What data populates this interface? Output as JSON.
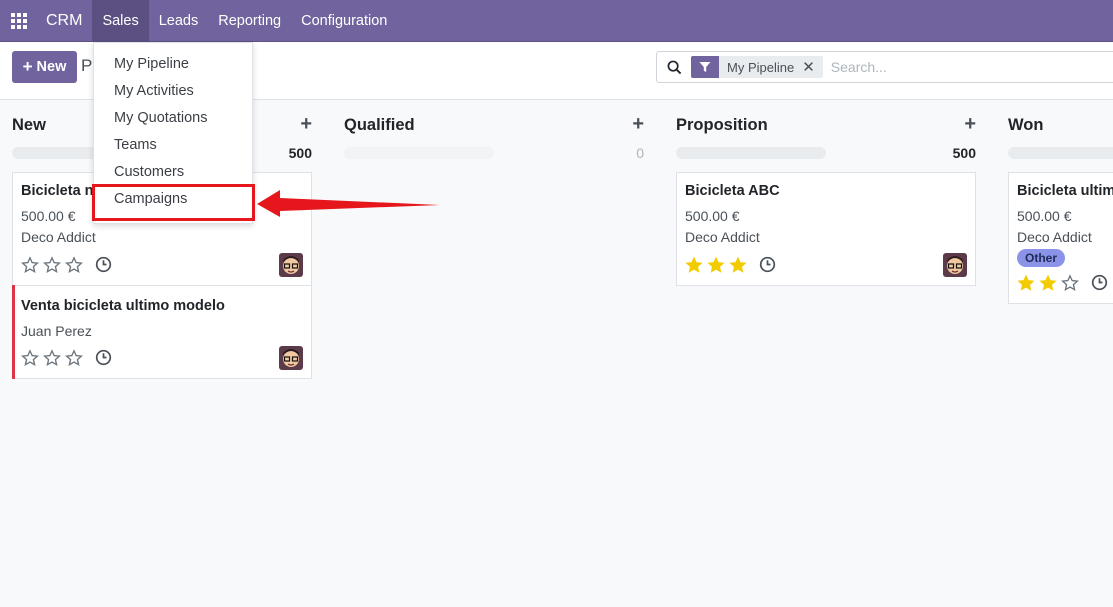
{
  "navbar": {
    "brand": "CRM",
    "items": [
      "Sales",
      "Leads",
      "Reporting",
      "Configuration"
    ]
  },
  "control_panel": {
    "new_label": "New",
    "breadcrumb": "Pi",
    "facet_label": "My Pipeline",
    "search_placeholder": "Search..."
  },
  "sales_menu": {
    "items": [
      "My Pipeline",
      "My Activities",
      "My Quotations",
      "Teams",
      "Customers",
      "Campaigns"
    ],
    "highlighted": "Campaigns"
  },
  "columns": [
    {
      "title": "New",
      "total": "500",
      "cards": [
        {
          "title": "Bicicleta n",
          "amount": "500.00 €",
          "customer": "Deco Addict",
          "stars": 0
        },
        {
          "title": "Venta bicicleta ultimo modelo",
          "customer": "Juan Perez",
          "stars": 0,
          "status": "red"
        }
      ]
    },
    {
      "title": "Qualified",
      "total": "0",
      "cards": []
    },
    {
      "title": "Proposition",
      "total": "500",
      "cards": [
        {
          "title": "Bicicleta ABC",
          "amount": "500.00 €",
          "customer": "Deco Addict",
          "stars": 3
        }
      ]
    },
    {
      "title": "Won",
      "cards": [
        {
          "title": "Bicicleta ultim",
          "amount": "500.00 €",
          "customer": "Deco Addict",
          "tag": "Other",
          "stars": 2
        }
      ]
    }
  ],
  "colors": {
    "brand": "#71639e",
    "star_filled": "#f3cc00",
    "highlight": "#e5171d"
  }
}
